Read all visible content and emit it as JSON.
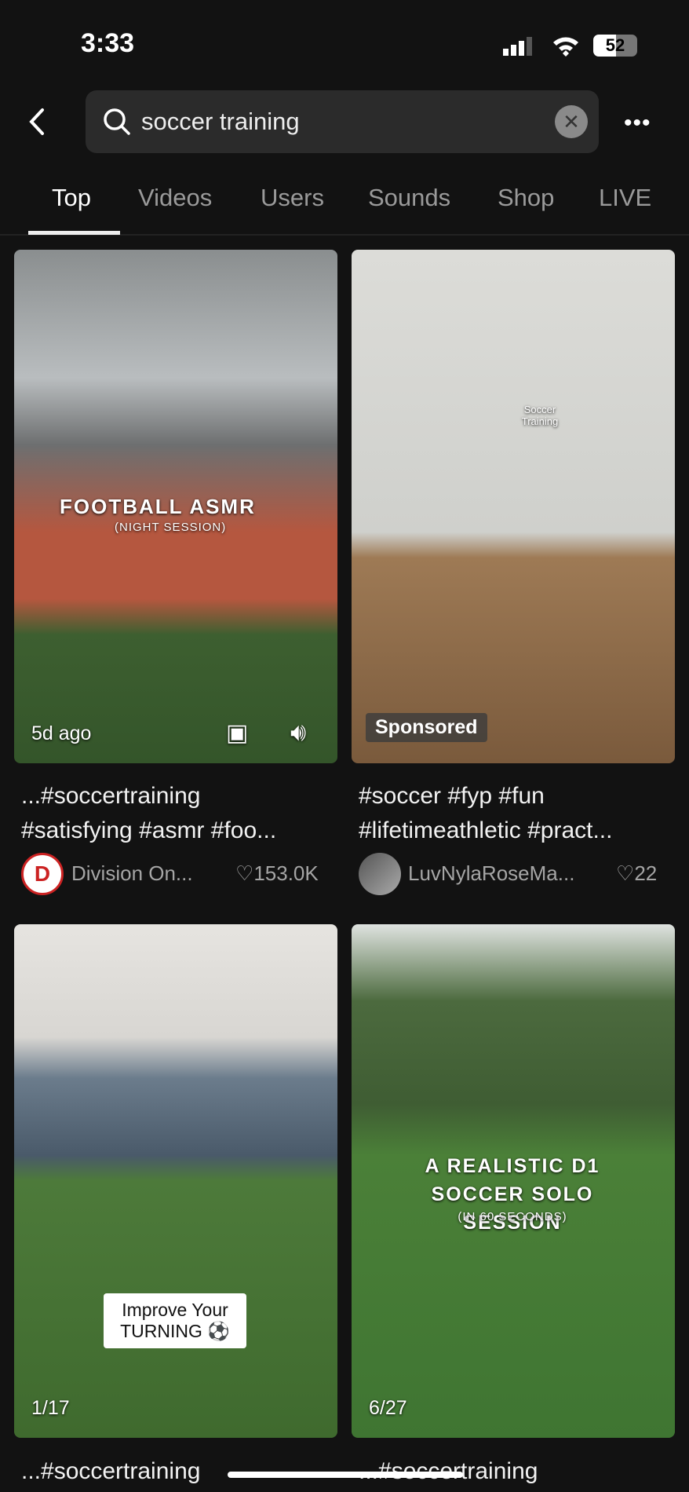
{
  "status": {
    "time": "3:33",
    "battery": "52"
  },
  "search": {
    "query": "soccer training"
  },
  "tabs": [
    {
      "label": "Top"
    },
    {
      "label": "Videos"
    },
    {
      "label": "Users"
    },
    {
      "label": "Sounds"
    },
    {
      "label": "Shop"
    },
    {
      "label": "LIVE"
    }
  ],
  "cards": [
    {
      "overlay_title": "FOOTBALL ASMR",
      "overlay_sub": "(NIGHT SESSION)",
      "badge": "5d ago",
      "caption1": "...#soccertraining",
      "caption2": "#satisfying #asmr #foo...",
      "author": "Division On...",
      "likes": "153.0K"
    },
    {
      "overlay_title": "Soccer Training",
      "badge": "Sponsored",
      "caption1": "#soccer #fyp #fun",
      "caption2": "#lifetimeathletic #pract...",
      "author": "LuvNylaRoseMa...",
      "likes": "22"
    },
    {
      "overlay_title": "Improve Your TURNING ⚽",
      "badge": "1/17",
      "caption1": "...#soccertraining"
    },
    {
      "overlay_title": "A REALISTIC D1 SOCCER SOLO SESSION",
      "overlay_sub": "(IN 60 SECONDS)",
      "badge": "6/27",
      "caption1": "...#soccertraining"
    }
  ]
}
